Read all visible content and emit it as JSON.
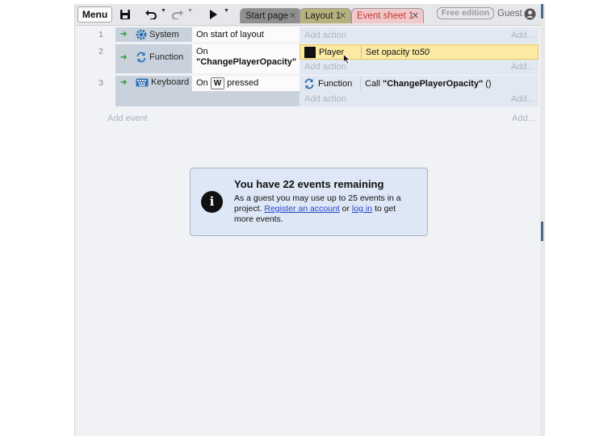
{
  "toolbar": {
    "menu_label": "Menu",
    "tabs": [
      {
        "label": "Start page"
      },
      {
        "label": "Layout 1"
      },
      {
        "label": "Event sheet 1"
      }
    ],
    "edition_label": "Free edition",
    "guest_label": "Guest"
  },
  "events": [
    {
      "number": "1",
      "object": "System",
      "object_icon": "gear-icon",
      "condition": "On start of layout",
      "actions": [],
      "add_action_label": "Add action",
      "add_right_label": "Add..."
    },
    {
      "number": "2",
      "object": "Function",
      "object_icon": "function-cycle-icon",
      "condition_line1": "On",
      "condition_line2": "\"ChangePlayerOpacity\"",
      "actions": [
        {
          "object": "Player",
          "text_prefix": "Set opacity to ",
          "value": "50",
          "highlighted": true
        }
      ],
      "add_action_label": "Add action",
      "add_right_label": "Add..."
    },
    {
      "number": "3",
      "object": "Keyboard",
      "object_icon": "keyboard-icon",
      "condition_prefix": "On",
      "condition_key": "W",
      "condition_suffix": "pressed",
      "actions": [
        {
          "object": "Function",
          "text_prefix": "Call ",
          "value": "\"ChangePlayerOpacity\"",
          "text_suffix": " ()"
        }
      ],
      "add_action_label": "Add action",
      "add_right_label": "Add..."
    }
  ],
  "add_event_label": "Add event",
  "add_event_right_label": "Add...",
  "info": {
    "title": "You have 22 events remaining",
    "body_1": "As a guest you may use up to 25 events in a project. ",
    "register_link": "Register an account",
    "body_2": " or ",
    "login_link": "log in",
    "body_3": " to get more events."
  },
  "colors": {
    "accent_link": "#2545c8",
    "highlight_action": "#fbeaa4",
    "event_sheet_tab": "#f1c8cb",
    "arrow_green": "#3aa14a"
  }
}
